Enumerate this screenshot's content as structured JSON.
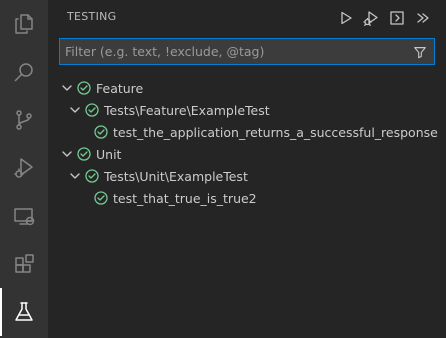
{
  "activity_bar": {
    "items": [
      {
        "name": "explorer",
        "icon": "files-icon"
      },
      {
        "name": "search",
        "icon": "search-icon"
      },
      {
        "name": "source-control",
        "icon": "source-control-icon"
      },
      {
        "name": "run-debug",
        "icon": "run-debug-icon"
      },
      {
        "name": "remote-explorer",
        "icon": "remote-explorer-icon"
      },
      {
        "name": "extensions",
        "icon": "extensions-icon"
      },
      {
        "name": "testing",
        "icon": "beaker-icon",
        "active": true
      }
    ]
  },
  "panel": {
    "title": "TESTING",
    "actions": [
      "run-tests-icon",
      "debug-tests-icon",
      "collapse-icon",
      "more-icon"
    ]
  },
  "filter": {
    "placeholder": "Filter (e.g. text, !exclude, @tag)",
    "value": ""
  },
  "tree": [
    {
      "label": "Feature",
      "status": "passed",
      "expanded": true
    },
    {
      "label": "Tests\\Feature\\ExampleTest",
      "status": "passed",
      "expanded": true
    },
    {
      "label": "test_the_application_returns_a_successful_response",
      "status": "passed"
    },
    {
      "label": "Unit",
      "status": "passed",
      "expanded": true
    },
    {
      "label": "Tests\\Unit\\ExampleTest",
      "status": "passed",
      "expanded": true
    },
    {
      "label": "test_that_true_is_true2",
      "status": "passed"
    }
  ],
  "colors": {
    "accent": "#007fd4",
    "pass": "#73c991",
    "sidebar_bg": "#252526",
    "activity_bg": "#333333"
  }
}
